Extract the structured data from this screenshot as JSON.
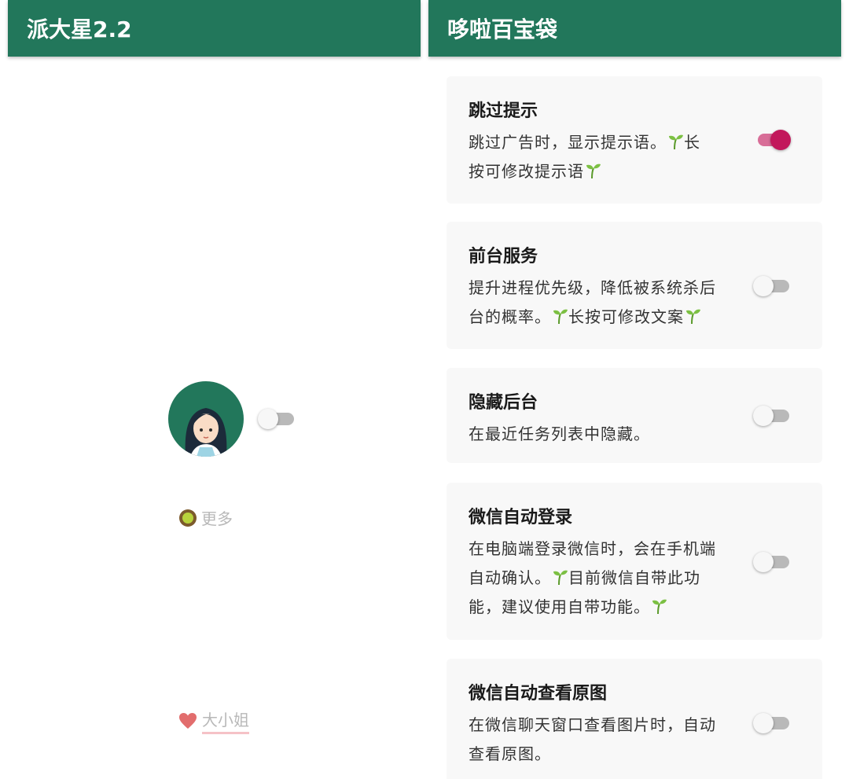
{
  "left_panel": {
    "title": "派大星2.2",
    "toggle_on": false,
    "more_label": "更多",
    "girl_label": "大小姐"
  },
  "right_panel": {
    "title": "哆啦百宝袋",
    "cards": [
      {
        "title": "跳过提示",
        "desc_line1": "跳过广告时，显示提示语。",
        "desc_line1_tail": "长",
        "desc_line2": "按可修改提示语",
        "enabled": true
      },
      {
        "title": "前台服务",
        "desc_line1": "提升进程优先级，降低被系统杀后",
        "desc_line2a": "台的概率。",
        "desc_line2b": "长按可修改文案",
        "enabled": false
      },
      {
        "title": "隐藏后台",
        "desc_line1": "在最近任务列表中隐藏。",
        "enabled": false
      },
      {
        "title": "微信自动登录",
        "desc_line1": "在电脑端登录微信时，会在手机端",
        "desc_line2a": "自动确认。",
        "desc_line2b": "目前微信自带此功",
        "desc_line3": "能，建议使用自带功能。",
        "enabled": false
      },
      {
        "title": "微信自动查看原图",
        "desc_line1": "在微信聊天窗口查看图片时，自动",
        "desc_line2": "查看原图。",
        "enabled": false
      }
    ]
  },
  "colors": {
    "appbar": "#22775b",
    "toggle_on_thumb": "#c2185b",
    "toggle_on_track": "#d86e98",
    "toggle_off_track": "#b9b9b9",
    "muted_text": "#b8b8b8"
  },
  "icons": [
    "avatar-girl-icon",
    "kiwi-icon",
    "heart-icon",
    "sprout-icon"
  ]
}
